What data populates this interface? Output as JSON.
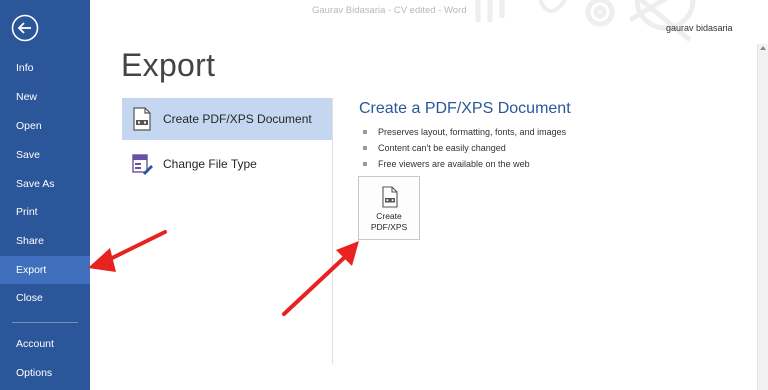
{
  "titlebar": {
    "title": "Gaurav Bidasaria - CV edited - Word",
    "user": "gaurav bidasaria"
  },
  "sidebar": {
    "items": [
      {
        "label": "Info"
      },
      {
        "label": "New"
      },
      {
        "label": "Open"
      },
      {
        "label": "Save"
      },
      {
        "label": "Save As"
      },
      {
        "label": "Print"
      },
      {
        "label": "Share"
      },
      {
        "label": "Export"
      },
      {
        "label": "Close"
      },
      {
        "label": "Account"
      },
      {
        "label": "Options"
      }
    ],
    "active": "Export"
  },
  "main": {
    "heading": "Export",
    "options": [
      {
        "label": "Create PDF/XPS Document",
        "icon": "pdf-document-icon",
        "selected": true
      },
      {
        "label": "Change File Type",
        "icon": "change-file-type-icon",
        "selected": false
      }
    ],
    "detail": {
      "heading": "Create a PDF/XPS Document",
      "bullets": [
        "Preserves layout, formatting, fonts, and images",
        "Content can't be easily changed",
        "Free viewers are available on the web"
      ],
      "button_label": "Create\nPDF/XPS",
      "button_icon": "pdf-xps-icon"
    }
  },
  "colors": {
    "sidebar": "#2b579a",
    "sidebar_active": "#3f6fbd",
    "option_selected": "#c5d7f0",
    "heading_blue": "#2b579a",
    "arrow": "#e8231f"
  }
}
